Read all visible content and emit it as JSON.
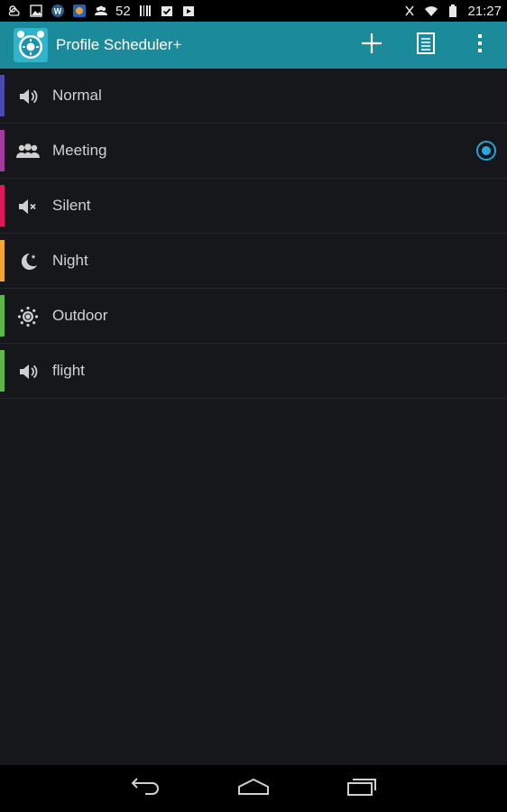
{
  "status_bar": {
    "notification_count": "52",
    "time": "21:27"
  },
  "action_bar": {
    "title": "Profile Scheduler+",
    "background": "#1b8a9b"
  },
  "profiles": [
    {
      "label": "Normal",
      "icon": "speaker-icon",
      "color": "#4a4ab0",
      "active": false
    },
    {
      "label": "Meeting",
      "icon": "people-icon",
      "color": "#a23aa0",
      "active": true
    },
    {
      "label": "Silent",
      "icon": "speaker-mute-icon",
      "color": "#e0195a",
      "active": false
    },
    {
      "label": "Night",
      "icon": "moon-icon",
      "color": "#f0a830",
      "active": false
    },
    {
      "label": "Outdoor",
      "icon": "sun-icon",
      "color": "#5cb848",
      "active": false
    },
    {
      "label": "flight",
      "icon": "speaker-icon",
      "color": "#5cb848",
      "active": false
    }
  ]
}
